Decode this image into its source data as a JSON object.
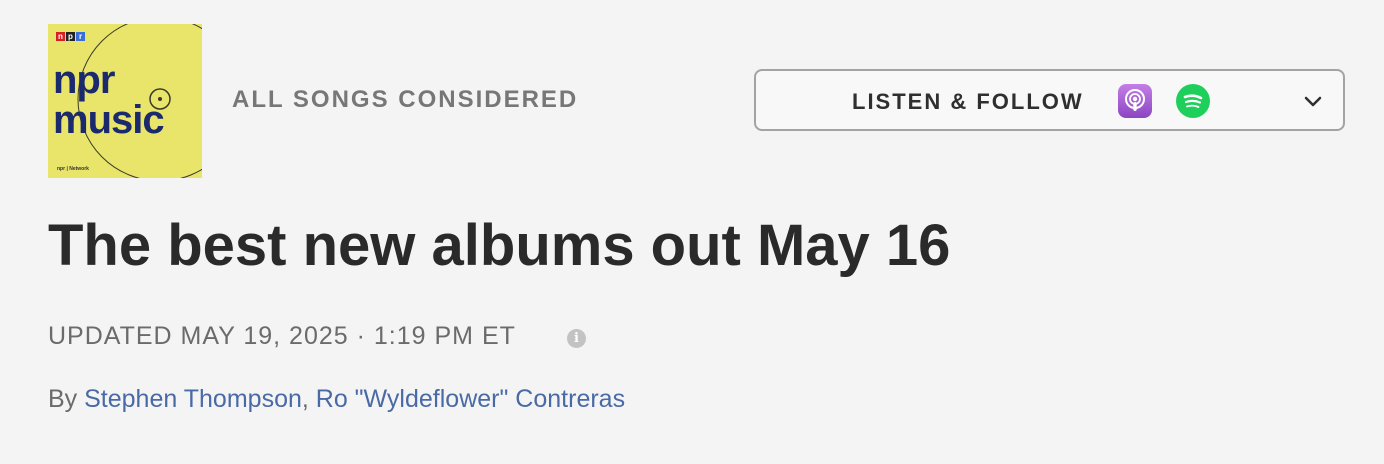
{
  "podcast": {
    "logo_letters": [
      "n",
      "p",
      "r"
    ],
    "art_line1": "npr",
    "art_line2": "music",
    "art_footer": "npr | Network",
    "show_name": "ALL SONGS CONSIDERED"
  },
  "listen_follow": {
    "label": "LISTEN & FOLLOW",
    "icons": [
      "apple-podcasts-icon",
      "spotify-icon",
      "chevron-down-icon"
    ]
  },
  "article": {
    "headline": "The best new albums out May 16",
    "dateline": "UPDATED MAY 19, 2025 · 1:19 PM ET",
    "info_glyph": "i",
    "byline_prefix": "By ",
    "author1": "Stephen Thompson",
    "separator": ", ",
    "author2": "Ro \"Wyldeflower\" Contreras"
  },
  "colors": {
    "art_bg": "#e8e56a",
    "art_text": "#1a2a6c",
    "link": "#4a6aa5",
    "podcasts": "#9a4fd0",
    "spotify": "#1fcf5c"
  }
}
